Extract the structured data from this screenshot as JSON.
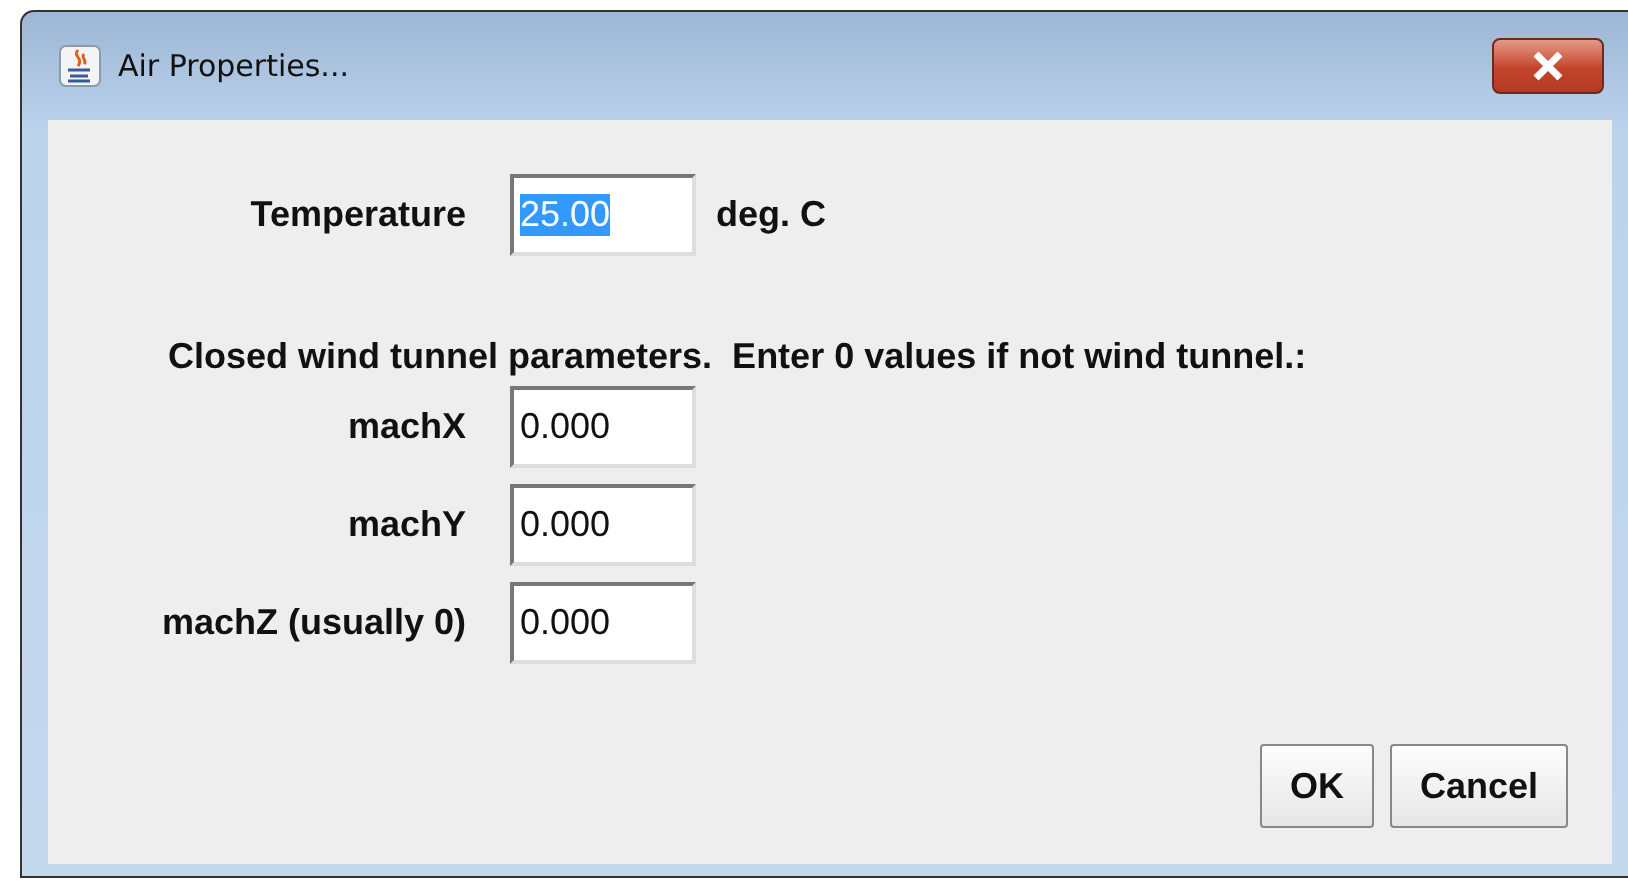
{
  "window": {
    "title": "Air Properties..."
  },
  "temperature": {
    "label": "Temperature",
    "value": "25.00",
    "selected": true,
    "unit": "deg. C"
  },
  "wind_tunnel": {
    "heading": "Closed wind tunnel parameters.  Enter 0 values if not wind tunnel.:",
    "fields": [
      {
        "label": "machX",
        "value": "0.000",
        "selected": false
      },
      {
        "label": "machY",
        "value": "0.000",
        "selected": false
      },
      {
        "label": "machZ (usually 0)",
        "value": "0.000",
        "selected": false
      }
    ]
  },
  "buttons": [
    {
      "label": "OK"
    },
    {
      "label": "Cancel"
    }
  ]
}
